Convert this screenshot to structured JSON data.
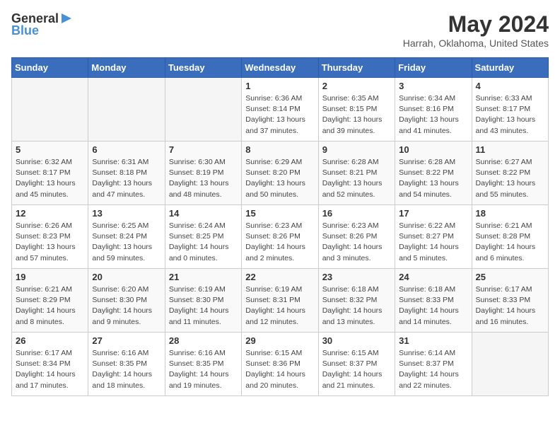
{
  "header": {
    "logo_general": "General",
    "logo_blue": "Blue",
    "title": "May 2024",
    "location": "Harrah, Oklahoma, United States"
  },
  "weekdays": [
    "Sunday",
    "Monday",
    "Tuesday",
    "Wednesday",
    "Thursday",
    "Friday",
    "Saturday"
  ],
  "weeks": [
    [
      {
        "day": "",
        "sunrise": "",
        "sunset": "",
        "daylight": ""
      },
      {
        "day": "",
        "sunrise": "",
        "sunset": "",
        "daylight": ""
      },
      {
        "day": "",
        "sunrise": "",
        "sunset": "",
        "daylight": ""
      },
      {
        "day": "1",
        "sunrise": "Sunrise: 6:36 AM",
        "sunset": "Sunset: 8:14 PM",
        "daylight": "Daylight: 13 hours and 37 minutes."
      },
      {
        "day": "2",
        "sunrise": "Sunrise: 6:35 AM",
        "sunset": "Sunset: 8:15 PM",
        "daylight": "Daylight: 13 hours and 39 minutes."
      },
      {
        "day": "3",
        "sunrise": "Sunrise: 6:34 AM",
        "sunset": "Sunset: 8:16 PM",
        "daylight": "Daylight: 13 hours and 41 minutes."
      },
      {
        "day": "4",
        "sunrise": "Sunrise: 6:33 AM",
        "sunset": "Sunset: 8:17 PM",
        "daylight": "Daylight: 13 hours and 43 minutes."
      }
    ],
    [
      {
        "day": "5",
        "sunrise": "Sunrise: 6:32 AM",
        "sunset": "Sunset: 8:17 PM",
        "daylight": "Daylight: 13 hours and 45 minutes."
      },
      {
        "day": "6",
        "sunrise": "Sunrise: 6:31 AM",
        "sunset": "Sunset: 8:18 PM",
        "daylight": "Daylight: 13 hours and 47 minutes."
      },
      {
        "day": "7",
        "sunrise": "Sunrise: 6:30 AM",
        "sunset": "Sunset: 8:19 PM",
        "daylight": "Daylight: 13 hours and 48 minutes."
      },
      {
        "day": "8",
        "sunrise": "Sunrise: 6:29 AM",
        "sunset": "Sunset: 8:20 PM",
        "daylight": "Daylight: 13 hours and 50 minutes."
      },
      {
        "day": "9",
        "sunrise": "Sunrise: 6:28 AM",
        "sunset": "Sunset: 8:21 PM",
        "daylight": "Daylight: 13 hours and 52 minutes."
      },
      {
        "day": "10",
        "sunrise": "Sunrise: 6:28 AM",
        "sunset": "Sunset: 8:22 PM",
        "daylight": "Daylight: 13 hours and 54 minutes."
      },
      {
        "day": "11",
        "sunrise": "Sunrise: 6:27 AM",
        "sunset": "Sunset: 8:22 PM",
        "daylight": "Daylight: 13 hours and 55 minutes."
      }
    ],
    [
      {
        "day": "12",
        "sunrise": "Sunrise: 6:26 AM",
        "sunset": "Sunset: 8:23 PM",
        "daylight": "Daylight: 13 hours and 57 minutes."
      },
      {
        "day": "13",
        "sunrise": "Sunrise: 6:25 AM",
        "sunset": "Sunset: 8:24 PM",
        "daylight": "Daylight: 13 hours and 59 minutes."
      },
      {
        "day": "14",
        "sunrise": "Sunrise: 6:24 AM",
        "sunset": "Sunset: 8:25 PM",
        "daylight": "Daylight: 14 hours and 0 minutes."
      },
      {
        "day": "15",
        "sunrise": "Sunrise: 6:23 AM",
        "sunset": "Sunset: 8:26 PM",
        "daylight": "Daylight: 14 hours and 2 minutes."
      },
      {
        "day": "16",
        "sunrise": "Sunrise: 6:23 AM",
        "sunset": "Sunset: 8:26 PM",
        "daylight": "Daylight: 14 hours and 3 minutes."
      },
      {
        "day": "17",
        "sunrise": "Sunrise: 6:22 AM",
        "sunset": "Sunset: 8:27 PM",
        "daylight": "Daylight: 14 hours and 5 minutes."
      },
      {
        "day": "18",
        "sunrise": "Sunrise: 6:21 AM",
        "sunset": "Sunset: 8:28 PM",
        "daylight": "Daylight: 14 hours and 6 minutes."
      }
    ],
    [
      {
        "day": "19",
        "sunrise": "Sunrise: 6:21 AM",
        "sunset": "Sunset: 8:29 PM",
        "daylight": "Daylight: 14 hours and 8 minutes."
      },
      {
        "day": "20",
        "sunrise": "Sunrise: 6:20 AM",
        "sunset": "Sunset: 8:30 PM",
        "daylight": "Daylight: 14 hours and 9 minutes."
      },
      {
        "day": "21",
        "sunrise": "Sunrise: 6:19 AM",
        "sunset": "Sunset: 8:30 PM",
        "daylight": "Daylight: 14 hours and 11 minutes."
      },
      {
        "day": "22",
        "sunrise": "Sunrise: 6:19 AM",
        "sunset": "Sunset: 8:31 PM",
        "daylight": "Daylight: 14 hours and 12 minutes."
      },
      {
        "day": "23",
        "sunrise": "Sunrise: 6:18 AM",
        "sunset": "Sunset: 8:32 PM",
        "daylight": "Daylight: 14 hours and 13 minutes."
      },
      {
        "day": "24",
        "sunrise": "Sunrise: 6:18 AM",
        "sunset": "Sunset: 8:33 PM",
        "daylight": "Daylight: 14 hours and 14 minutes."
      },
      {
        "day": "25",
        "sunrise": "Sunrise: 6:17 AM",
        "sunset": "Sunset: 8:33 PM",
        "daylight": "Daylight: 14 hours and 16 minutes."
      }
    ],
    [
      {
        "day": "26",
        "sunrise": "Sunrise: 6:17 AM",
        "sunset": "Sunset: 8:34 PM",
        "daylight": "Daylight: 14 hours and 17 minutes."
      },
      {
        "day": "27",
        "sunrise": "Sunrise: 6:16 AM",
        "sunset": "Sunset: 8:35 PM",
        "daylight": "Daylight: 14 hours and 18 minutes."
      },
      {
        "day": "28",
        "sunrise": "Sunrise: 6:16 AM",
        "sunset": "Sunset: 8:35 PM",
        "daylight": "Daylight: 14 hours and 19 minutes."
      },
      {
        "day": "29",
        "sunrise": "Sunrise: 6:15 AM",
        "sunset": "Sunset: 8:36 PM",
        "daylight": "Daylight: 14 hours and 20 minutes."
      },
      {
        "day": "30",
        "sunrise": "Sunrise: 6:15 AM",
        "sunset": "Sunset: 8:37 PM",
        "daylight": "Daylight: 14 hours and 21 minutes."
      },
      {
        "day": "31",
        "sunrise": "Sunrise: 6:14 AM",
        "sunset": "Sunset: 8:37 PM",
        "daylight": "Daylight: 14 hours and 22 minutes."
      },
      {
        "day": "",
        "sunrise": "",
        "sunset": "",
        "daylight": ""
      }
    ]
  ]
}
